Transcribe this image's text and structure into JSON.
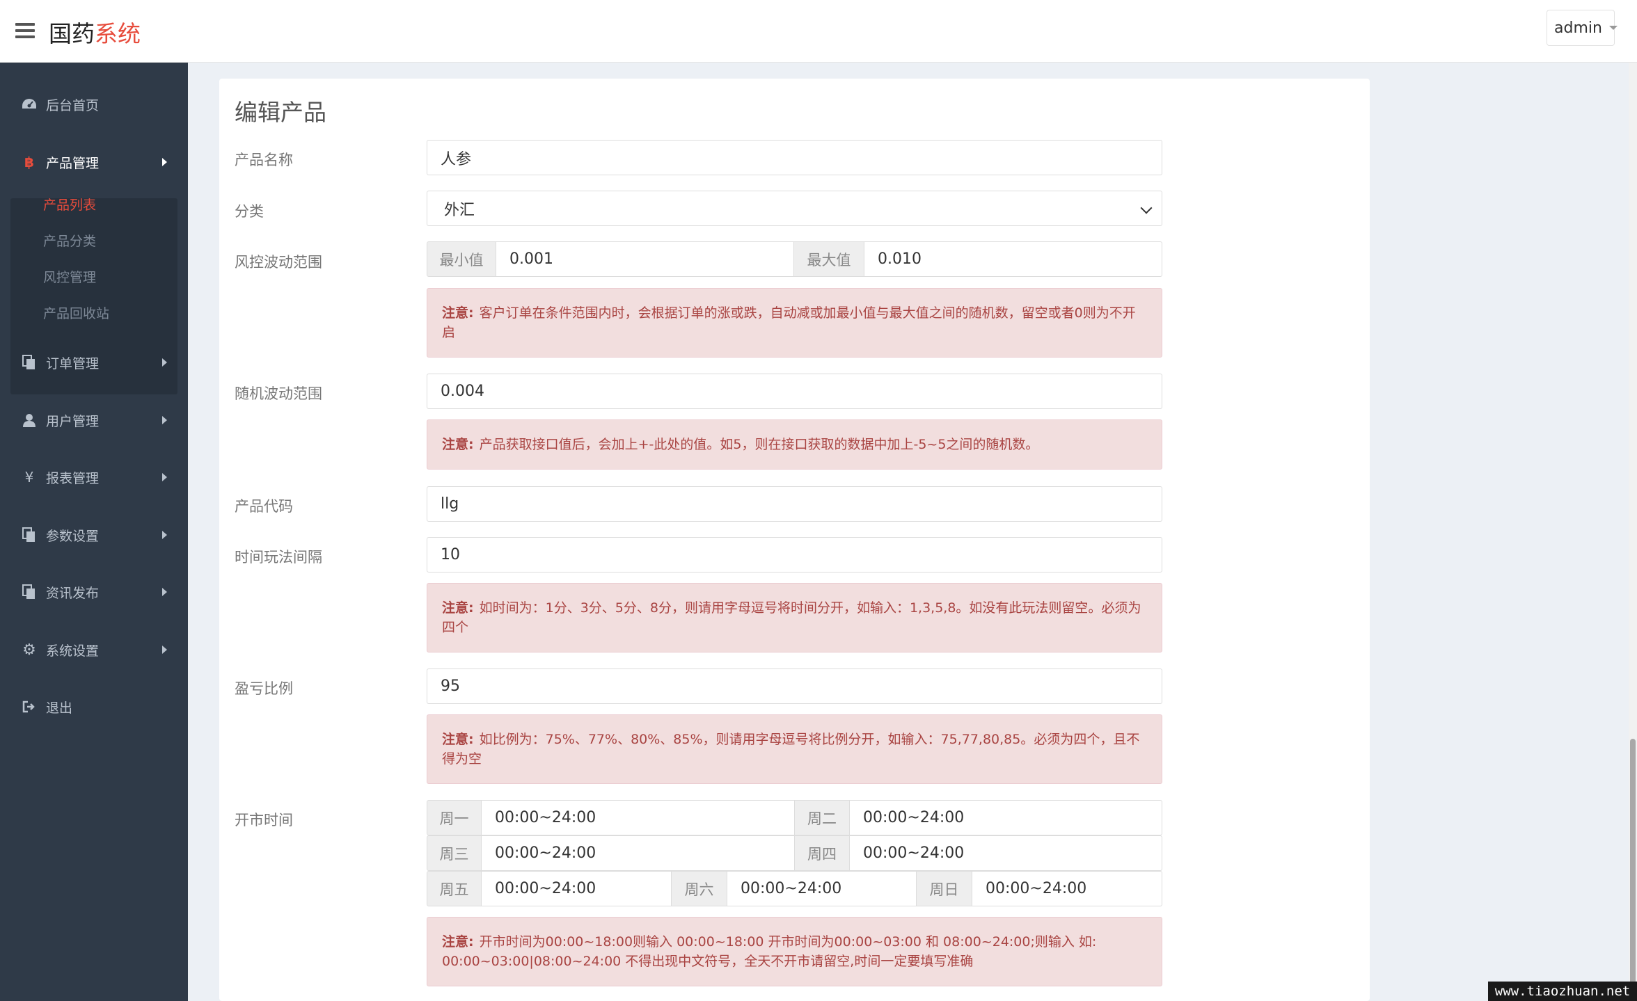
{
  "header": {
    "brand_main": "国药",
    "brand_accent": "系统",
    "user": "admin"
  },
  "sidebar": {
    "items": [
      {
        "label": "后台首页",
        "icon": "dashboard-icon"
      },
      {
        "label": "产品管理",
        "icon": "bitcoin-icon"
      },
      {
        "label": "订单管理",
        "icon": "copy-icon"
      },
      {
        "label": "用户管理",
        "icon": "user-icon"
      },
      {
        "label": "报表管理",
        "icon": "yen-icon"
      },
      {
        "label": "参数设置",
        "icon": "copy-icon"
      },
      {
        "label": "资讯发布",
        "icon": "copy-icon"
      },
      {
        "label": "系统设置",
        "icon": "gears-icon"
      },
      {
        "label": "退出",
        "icon": "sign-out-icon"
      }
    ],
    "sub_items": [
      "产品列表",
      "产品分类",
      "风控管理",
      "产品回收站"
    ]
  },
  "form": {
    "title": "编辑产品",
    "name_label": "产品名称",
    "name_value": "人参",
    "category_label": "分类",
    "category_value": "外汇",
    "risk_label": "风控波动范围",
    "risk_min_addon": "最小值",
    "risk_min": "0.001",
    "risk_max_addon": "最大值",
    "risk_max": "0.010",
    "alert_prefix": "注意:",
    "risk_note": "客户订单在条件范围内时，会根据订单的涨或跌，自动减或加最小值与最大值之间的随机数，留空或者0则为不开启",
    "random_label": "随机波动范围",
    "random_value": "0.004",
    "random_note": "产品获取接口值后，会加上+-此处的值。如5，则在接口获取的数据中加上-5~5之间的随机数。",
    "code_label": "产品代码",
    "code_value": "llg",
    "interval_label": "时间玩法间隔",
    "interval_value": "10",
    "interval_note": "如时间为：1分、3分、5分、8分，则请用字母逗号将时间分开，如输入：1,3,5,8。如没有此玩法则留空。必须为四个",
    "ratio_label": "盈亏比例",
    "ratio_value": "95",
    "ratio_note": "如比例为：75%、77%、80%、85%，则请用字母逗号将比例分开，如输入：75,77,80,85。必须为四个，且不得为空",
    "open_label": "开市时间",
    "days": [
      {
        "day": "周一",
        "time": "00:00~24:00"
      },
      {
        "day": "周二",
        "time": "00:00~24:00"
      },
      {
        "day": "周三",
        "time": "00:00~24:00"
      },
      {
        "day": "周四",
        "time": "00:00~24:00"
      },
      {
        "day": "周五",
        "time": "00:00~24:00"
      },
      {
        "day": "周六",
        "time": "00:00~24:00"
      },
      {
        "day": "周日",
        "time": "00:00~24:00"
      }
    ],
    "open_note": "开市时间为00:00~18:00则输入 00:00~18:00 开市时间为00:00~03:00 和 08:00~24:00;则输入 如: 00:00~03:00|08:00~24:00 不得出现中文符号，全天不开市请留空,时间一定要填写准确"
  },
  "watermark": "www.tiaozhuan.net",
  "colors": {
    "accent": "#e74c3c",
    "sidebar": "#2f3a48",
    "alert_bg": "#f2dede",
    "alert_text": "#a94442"
  }
}
